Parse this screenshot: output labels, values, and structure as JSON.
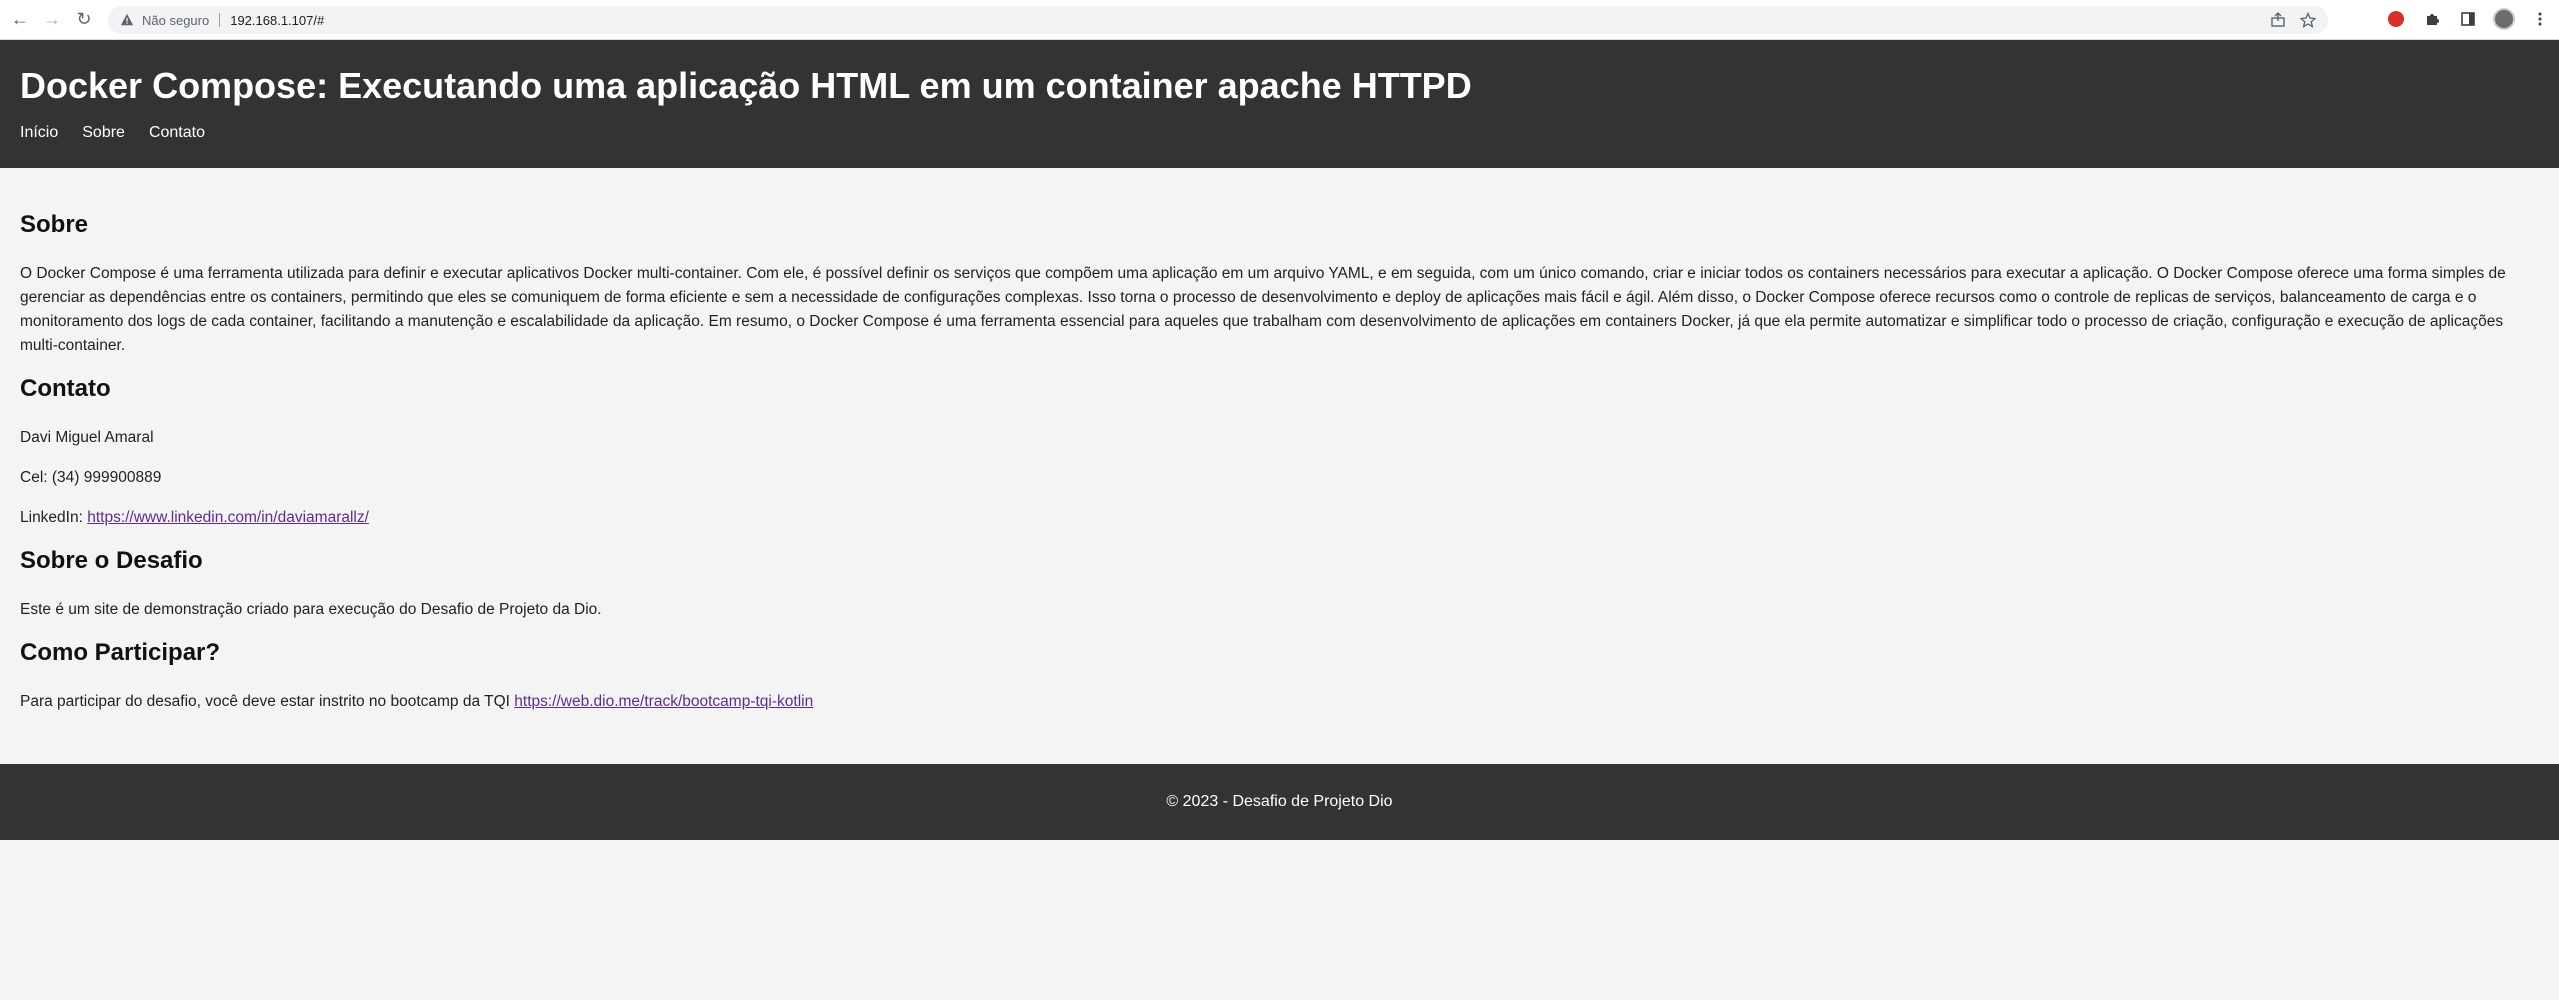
{
  "browser": {
    "not_secure": "Não seguro",
    "url": "192.168.1.107/#",
    "back_icon": "←",
    "forward_icon": "→",
    "reload_icon": "↻"
  },
  "header": {
    "title": "Docker Compose: Executando uma aplicação HTML em um container apache HTTPD",
    "nav": [
      "Início",
      "Sobre",
      "Contato"
    ]
  },
  "sobre": {
    "heading": "Sobre",
    "text": "O Docker Compose é uma ferramenta utilizada para definir e executar aplicativos Docker multi-container. Com ele, é possível definir os serviços que compõem uma aplicação em um arquivo YAML, e em seguida, com um único comando, criar e iniciar todos os containers necessários para executar a aplicação. O Docker Compose oferece uma forma simples de gerenciar as dependências entre os containers, permitindo que eles se comuniquem de forma eficiente e sem a necessidade de configurações complexas. Isso torna o processo de desenvolvimento e deploy de aplicações mais fácil e ágil. Além disso, o Docker Compose oferece recursos como o controle de replicas de serviços, balanceamento de carga e o monitoramento dos logs de cada container, facilitando a manutenção e escalabilidade da aplicação. Em resumo, o Docker Compose é uma ferramenta essencial para aqueles que trabalham com desenvolvimento de aplicações em containers Docker, já que ela permite automatizar e simplificar todo o processo de criação, configuração e execução de aplicações multi-container."
  },
  "contato": {
    "heading": "Contato",
    "name": "Davi Miguel Amaral",
    "phone": "Cel: (34) 999900889",
    "linkedin_label": "LinkedIn: ",
    "linkedin_url": "https://www.linkedin.com/in/daviamarallz/"
  },
  "desafio": {
    "heading": "Sobre o Desafio",
    "text": "Este é um site de demonstração criado para execução do Desafio de Projeto da Dio."
  },
  "participar": {
    "heading": "Como Participar?",
    "text": "Para participar do desafio, você deve estar instrito no bootcamp da TQI ",
    "link": "https://web.dio.me/track/bootcamp-tqi-kotlin"
  },
  "footer": {
    "text": "© 2023 - Desafio de Projeto Dio"
  }
}
